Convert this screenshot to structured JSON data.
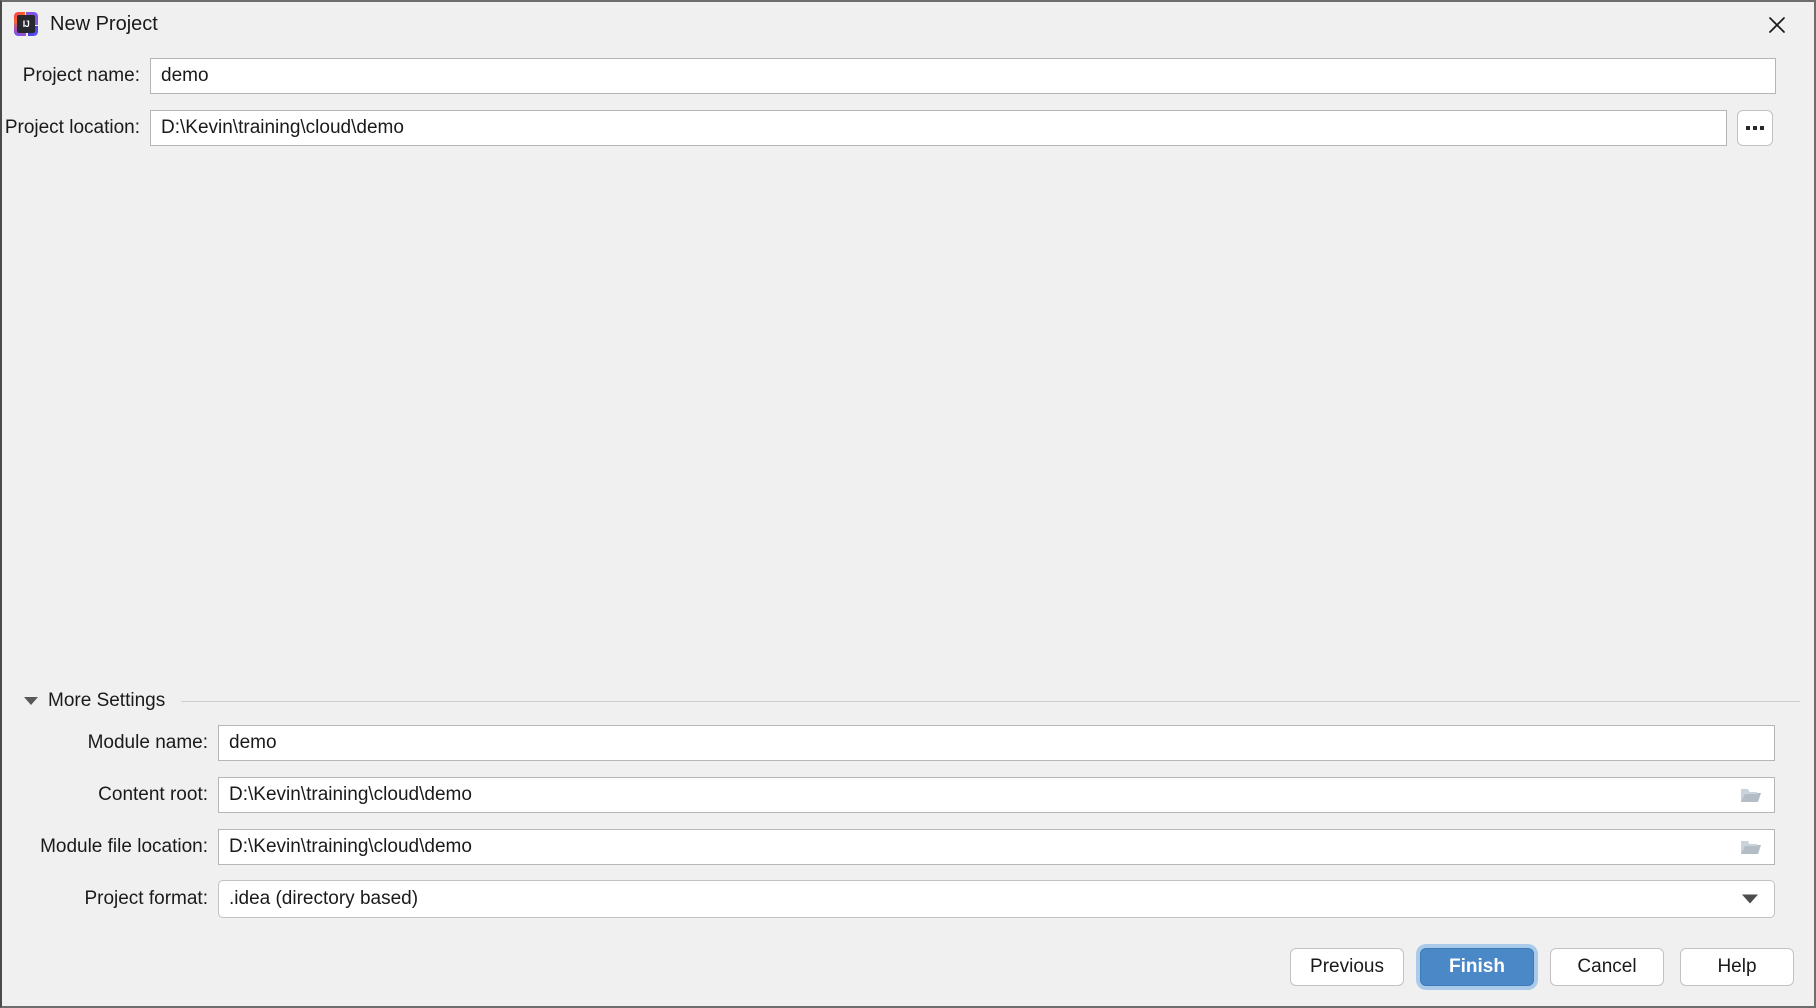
{
  "window": {
    "title": "New Project",
    "app_icon": "intellij-idea-icon",
    "icon_text": "IJ",
    "close_icon": "close-icon"
  },
  "top_form": {
    "project_name": {
      "label": "Project name:",
      "value": "demo",
      "placeholder": ""
    },
    "project_location": {
      "label": "Project location:",
      "value": "D:\\Kevin\\training\\cloud\\demo",
      "placeholder": "",
      "browse_icon": "ellipsis-icon"
    }
  },
  "more_settings": {
    "label": "More Settings",
    "expanded": true,
    "toggle_icon": "chevron-down-icon"
  },
  "bottom_form": {
    "module_name": {
      "label": "Module name:",
      "value": "demo",
      "placeholder": ""
    },
    "content_root": {
      "label": "Content root:",
      "value": "D:\\Kevin\\training\\cloud\\demo",
      "placeholder": "",
      "browse_icon": "folder-icon"
    },
    "module_file_location": {
      "label": "Module file location:",
      "value": "D:\\Kevin\\training\\cloud\\demo",
      "placeholder": "",
      "browse_icon": "folder-icon"
    },
    "project_format": {
      "label": "Project format:",
      "value": ".idea (directory based)",
      "dropdown_icon": "triangle-down-icon",
      "options": [
        ".idea (directory based)"
      ]
    }
  },
  "footer": {
    "previous_label": "Previous",
    "finish_label": "Finish",
    "cancel_label": "Cancel",
    "help_label": "Help"
  },
  "colors": {
    "dialog_background": "#f0f0f0",
    "field_background": "#ffffff",
    "field_border": "#b6b6b6",
    "text": "#1a1a1a",
    "default_button_fill": "#4a88c7",
    "default_button_focus_ring": "#a9cbe9",
    "separator": "#cfcfcf",
    "folder_icon": "#b4bcc6"
  }
}
